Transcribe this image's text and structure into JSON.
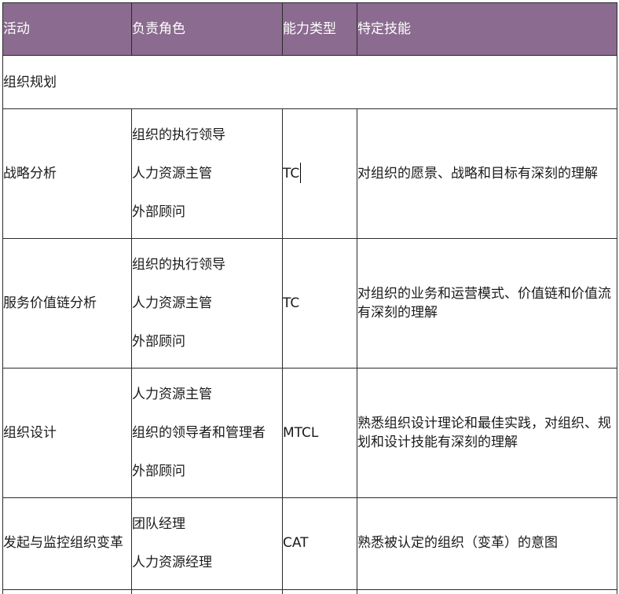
{
  "table": {
    "headers": [
      "活动",
      "负责角色",
      "能力类型",
      "特定技能"
    ],
    "section_label": "组织规划",
    "rows": [
      {
        "activity": "战略分析",
        "roles": [
          "组织的执行领导",
          "人力资源主管",
          "外部顾问"
        ],
        "capability": "TC",
        "skill": "对组织的愿景、战略和目标有深刻的理解"
      },
      {
        "activity": "服务价值链分析",
        "roles": [
          "组织的执行领导",
          "人力资源主管",
          "外部顾问"
        ],
        "capability": "TC",
        "skill": "对组织的业务和运营模式、价值链和价值流有深刻的理解"
      },
      {
        "activity": "组织设计",
        "roles": [
          "人力资源主管",
          "组织的领导者和管理者",
          "外部顾问"
        ],
        "capability": "MTCL",
        "skill": "熟悉组织设计理论和最佳实践，对组织、规划和设计技能有深刻的理解"
      },
      {
        "activity": "发起与监控组织变革",
        "roles": [
          "团队经理",
          "人力资源经理"
        ],
        "capability": "CAT",
        "skill": "熟悉被认定的组织（变革）的意图"
      }
    ]
  },
  "colors": {
    "header_bg": "#8b6b8f",
    "header_text": "#ffffff",
    "border": "#2b2b2b"
  }
}
